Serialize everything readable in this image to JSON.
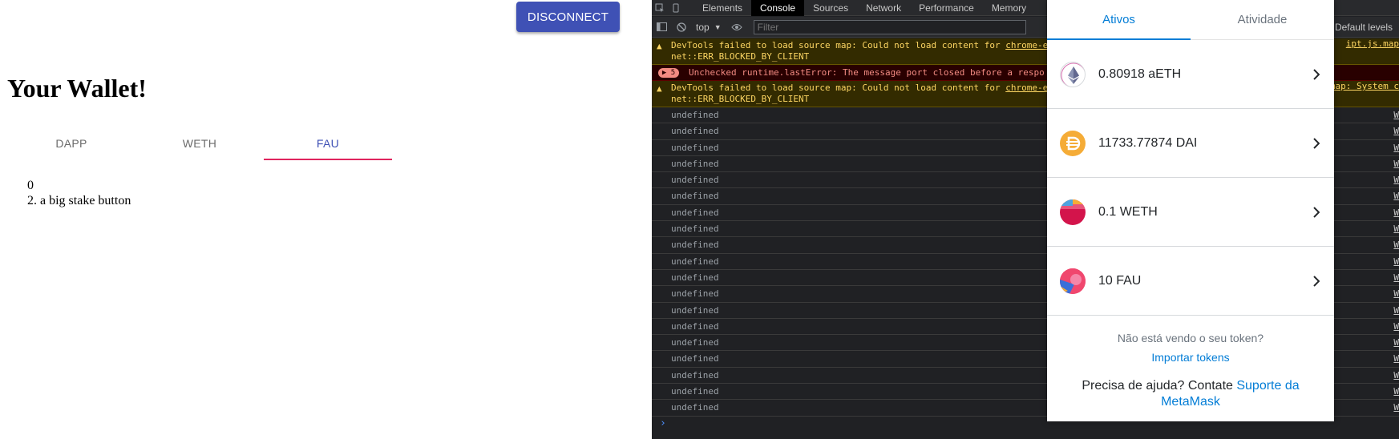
{
  "app": {
    "disconnect_label": "DISCONNECT",
    "title": "Your Wallet!",
    "tabs": [
      {
        "label": "DAPP",
        "active": false
      },
      {
        "label": "WETH",
        "active": false
      },
      {
        "label": "FAU",
        "active": true
      }
    ],
    "content": {
      "balance": "0",
      "line2": "2. a big stake button"
    },
    "colors": {
      "primary": "#3f51b5",
      "tab_indicator": "#e0245e"
    }
  },
  "devtools": {
    "tabs": [
      "Elements",
      "Console",
      "Sources",
      "Network",
      "Performance",
      "Memory"
    ],
    "active_tab": "Console",
    "context": "top",
    "filter_placeholder": "Filter",
    "levels_label": "Default levels",
    "messages": {
      "warn1": {
        "prefix": "DevTools failed to load source map: Could not load content for ",
        "link": "chrome-e",
        "line2": "net::ERR_BLOCKED_BY_CLIENT",
        "source": "ipt.js.map"
      },
      "error": {
        "count": "5",
        "text": "Unchecked runtime.lastError: The message port closed before a respo"
      },
      "warn2": {
        "prefix": "DevTools failed to load source map: Could not load content for ",
        "link": "chrome-e",
        "line2": "net::ERR_BLOCKED_BY_CLIENT",
        "source": "map: System c"
      },
      "log_text": "undefined",
      "log_source": "W"
    }
  },
  "metamask": {
    "tabs": [
      {
        "label": "Ativos",
        "active": true
      },
      {
        "label": "Atividade",
        "active": false
      }
    ],
    "assets": [
      {
        "label": "0.80918 aETH",
        "icon": "ethereum-icon"
      },
      {
        "label": "11733.77874 DAI",
        "icon": "dai-icon"
      },
      {
        "label": "0.1 WETH",
        "icon": "weth-icon"
      },
      {
        "label": "10 FAU",
        "icon": "fau-icon"
      }
    ],
    "footer": {
      "hint": "Não está vendo o seu token?",
      "import_link": "Importar tokens",
      "help_prefix": "Precisa de ajuda? Contate ",
      "help_link": "Suporte da MetaMask"
    },
    "colors": {
      "link": "#037dd6",
      "dai": "#f5ac37"
    }
  }
}
